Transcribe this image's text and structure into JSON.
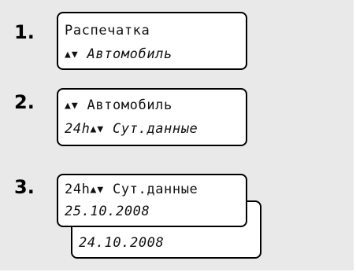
{
  "steps": [
    {
      "number": "1.",
      "lines": [
        {
          "text": "Распечатка",
          "prefix": "",
          "symbol": ""
        },
        {
          "text": "Автомобиль",
          "prefix": "",
          "symbol": "▲▼"
        }
      ]
    },
    {
      "number": "2.",
      "lines": [
        {
          "text": "Автомобиль",
          "prefix": "",
          "symbol": "▲▼"
        },
        {
          "text": "Сут.данные",
          "prefix": "24h",
          "symbol": "▲▼"
        }
      ]
    },
    {
      "number": "3.",
      "front": [
        {
          "text": "Сут.данные",
          "prefix": "24h",
          "symbol": "▲▼"
        },
        {
          "text": "25.10.2008",
          "prefix": "",
          "symbol": ""
        }
      ],
      "back": [
        {
          "text": "24.10.2008",
          "prefix": "",
          "symbol": ""
        }
      ]
    }
  ]
}
